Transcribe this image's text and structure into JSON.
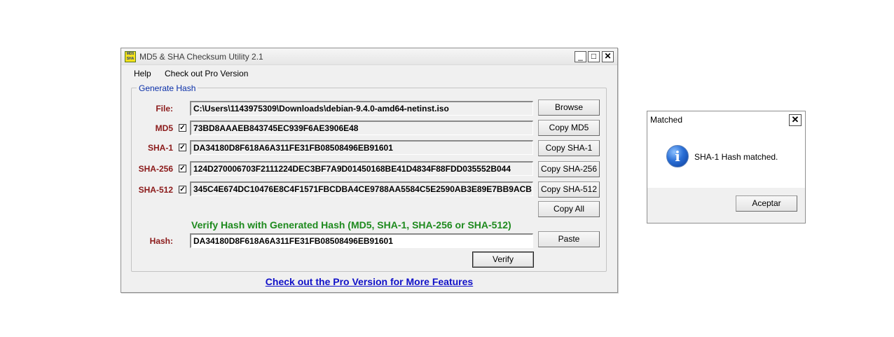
{
  "window": {
    "title": "MD5 & SHA Checksum Utility 2.1",
    "icon_text": "MD5 SHA",
    "minimize": "_",
    "maximize": "□",
    "close": "✕"
  },
  "menu": {
    "items": [
      "Help",
      "Check out Pro Version"
    ]
  },
  "group": {
    "title": "Generate Hash"
  },
  "file": {
    "label": "File:",
    "value": "C:\\Users\\1143975309\\Downloads\\debian-9.4.0-amd64-netinst.iso",
    "button": "Browse"
  },
  "hashes": [
    {
      "label": "MD5",
      "checked": "✓",
      "value": "73BD8AAAEB843745EC939F6AE3906E48",
      "button": "Copy MD5"
    },
    {
      "label": "SHA-1",
      "checked": "✓",
      "value": "DA34180D8F618A6A311FE31FB08508496EB91601",
      "button": "Copy SHA-1"
    },
    {
      "label": "SHA-256",
      "checked": "✓",
      "value": "124D270006703F2111224DEC3BF7A9D01450168BE41D4834F88FDD035552B044",
      "button": "Copy SHA-256"
    },
    {
      "label": "SHA-512",
      "checked": "✓",
      "value": "345C4E674DC10476E8C4F1571FBCDBA4CE9788AA5584C5E2590AB3E89E7BB9ACB",
      "button": "Copy SHA-512"
    }
  ],
  "copy_all": "Copy All",
  "verify": {
    "title": "Verify Hash with Generated Hash (MD5, SHA-1, SHA-256 or SHA-512)",
    "hash_label": "Hash:",
    "hash_value": "DA34180D8F618A6A311FE31FB08508496EB91601",
    "paste_button": "Paste",
    "verify_button": "Verify"
  },
  "pro_link": "Check out the Pro Version for More Features",
  "dialog": {
    "title": "Matched",
    "close": "✕",
    "icon": "i",
    "message": "SHA-1 Hash matched.",
    "ok_button": "Aceptar"
  },
  "colors": {
    "label_red": "#8b1a1a",
    "group_title_blue": "#0a2fa8",
    "verify_green": "#1e8a1e",
    "link_blue": "#1010c8"
  }
}
